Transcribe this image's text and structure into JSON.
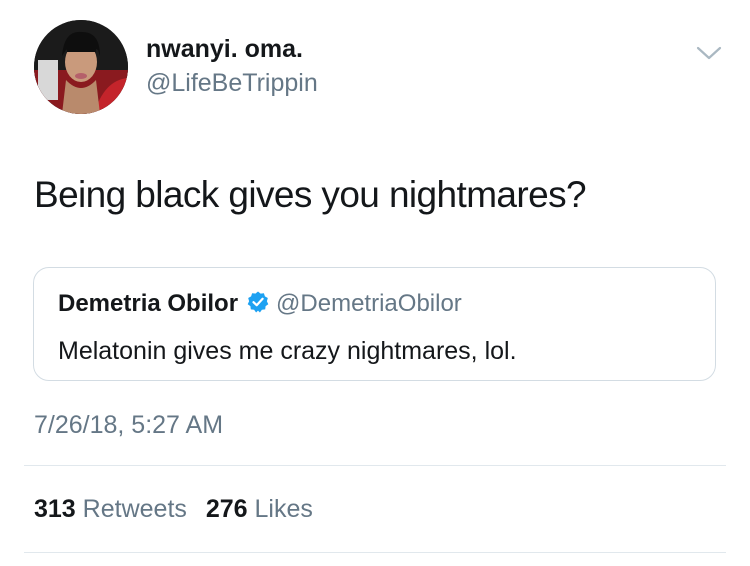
{
  "author": {
    "display_name": "nwanyi. oma.",
    "handle": "@LifeBeTrippin"
  },
  "tweet": {
    "text": "Being black gives you nightmares?",
    "timestamp": "7/26/18, 5:27 AM"
  },
  "quoted_tweet": {
    "display_name": "Demetria Obilor",
    "handle": "@DemetriaObilor",
    "text": "Melatonin gives me crazy nightmares, lol.",
    "verified": true
  },
  "stats": {
    "retweets_count": "313",
    "retweets_label": "Retweets",
    "likes_count": "276",
    "likes_label": "Likes"
  },
  "icons": {
    "caret": "chevron-down-icon",
    "verified": "verified-badge-icon"
  },
  "colors": {
    "primary_text": "#14171a",
    "secondary_text": "#657786",
    "verified_blue": "#1da1f2",
    "border": "#d3dce3"
  }
}
